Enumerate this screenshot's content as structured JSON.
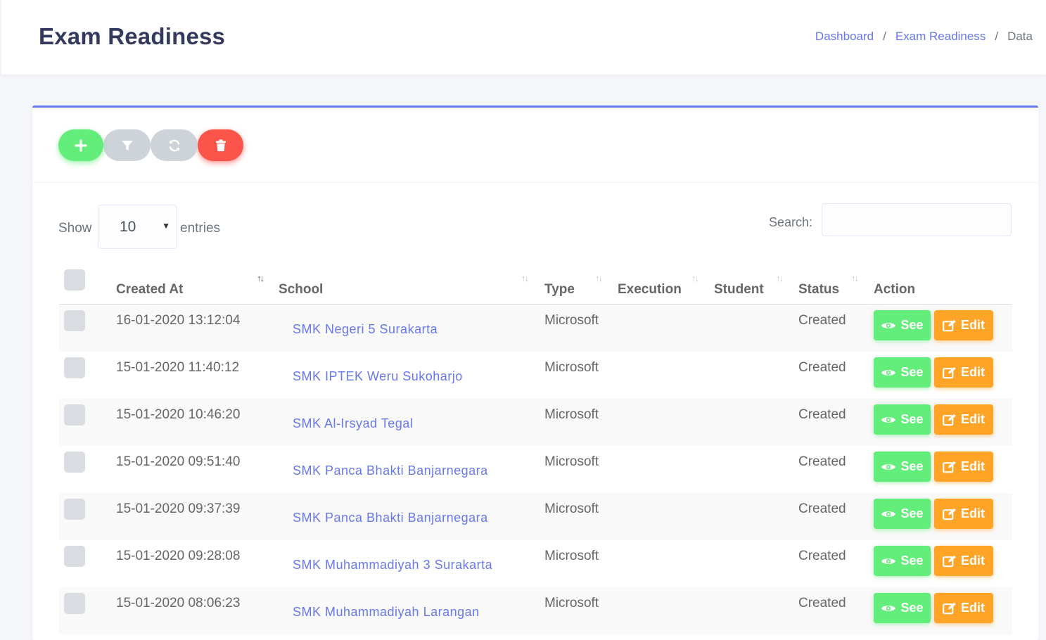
{
  "header": {
    "title": "Exam Readiness",
    "breadcrumb": [
      "Dashboard",
      "Exam Readiness",
      "Data"
    ],
    "breadcrumb_sep": "/"
  },
  "toolbar": {
    "add_icon": "plus-icon",
    "filter_icon": "filter-icon",
    "refresh_icon": "refresh-icon",
    "delete_icon": "trash-icon"
  },
  "length": {
    "show_label": "Show",
    "value": "10",
    "entries_label": "entries"
  },
  "search": {
    "label": "Search:",
    "value": ""
  },
  "table": {
    "columns": [
      "Created At",
      "School",
      "Type",
      "Execution",
      "Student",
      "Status",
      "Action"
    ],
    "see_label": "See",
    "edit_label": "Edit",
    "rows": [
      {
        "created_at": "16-01-2020 13:12:04",
        "school": "SMK Negeri 5 Surakarta",
        "type": "Microsoft",
        "execution": "",
        "student": "",
        "status": "Created"
      },
      {
        "created_at": "15-01-2020 11:40:12",
        "school": "SMK IPTEK Weru Sukoharjo",
        "type": "Microsoft",
        "execution": "",
        "student": "",
        "status": "Created"
      },
      {
        "created_at": "15-01-2020 10:46:20",
        "school": "SMK Al-Irsyad Tegal",
        "type": "Microsoft",
        "execution": "",
        "student": "",
        "status": "Created"
      },
      {
        "created_at": "15-01-2020 09:51:40",
        "school": "SMK Panca Bhakti Banjarnegara",
        "type": "Microsoft",
        "execution": "",
        "student": "",
        "status": "Created"
      },
      {
        "created_at": "15-01-2020 09:37:39",
        "school": "SMK Panca Bhakti Banjarnegara",
        "type": "Microsoft",
        "execution": "",
        "student": "",
        "status": "Created"
      },
      {
        "created_at": "15-01-2020 09:28:08",
        "school": "SMK Muhammadiyah 3 Surakarta",
        "type": "Microsoft",
        "execution": "",
        "student": "",
        "status": "Created"
      },
      {
        "created_at": "15-01-2020 08:06:23",
        "school": "SMK Muhammadiyah Larangan",
        "type": "Microsoft",
        "execution": "",
        "student": "",
        "status": "Created"
      }
    ]
  },
  "colors": {
    "primary": "#6777ef",
    "success": "#63ed7a",
    "warning": "#ffa426",
    "danger": "#fc544b",
    "secondary": "#cdd3d8"
  }
}
